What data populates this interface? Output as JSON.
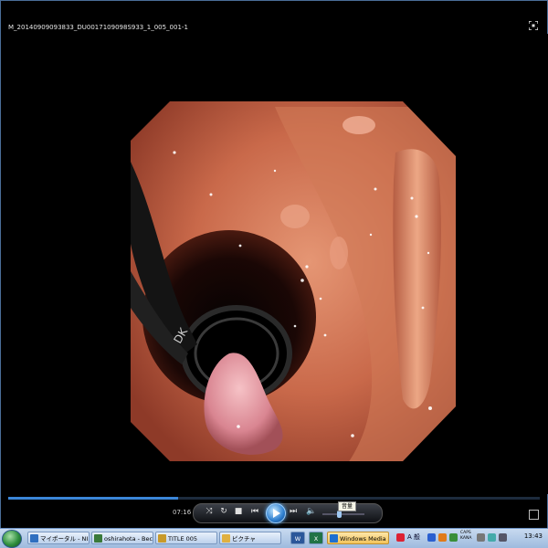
{
  "window": {
    "title": "M_20140909093833_DU0017109098S933_1_005_001-1"
  },
  "player": {
    "elapsed_time": "07:16",
    "progress_fraction": 0.32,
    "volume_fraction": 0.35,
    "volume_tooltip": "音量",
    "buttons": [
      "shuffle",
      "repeat",
      "stop",
      "previous",
      "play",
      "next",
      "mute"
    ]
  },
  "taskbar": {
    "items": [
      {
        "label": "マイポータル - NI...",
        "color": "#2f6fc0"
      },
      {
        "label": "oshirahota - Bec...",
        "color": "#3a7a3a"
      },
      {
        "label": "TITLE 005",
        "color": "#c89a2a"
      },
      {
        "label": "ピクチャ",
        "color": "#e0b040"
      },
      {
        "label": "W",
        "color": "#2b579a"
      },
      {
        "label": "X",
        "color": "#217346"
      },
      {
        "label": "Windows Media ...",
        "color": "#1e6fd0",
        "active": true
      }
    ],
    "tray_text_top": "CAPS",
    "tray_text_bottom": "KANA",
    "ime_mode": "A 般",
    "clock": "13:43"
  }
}
